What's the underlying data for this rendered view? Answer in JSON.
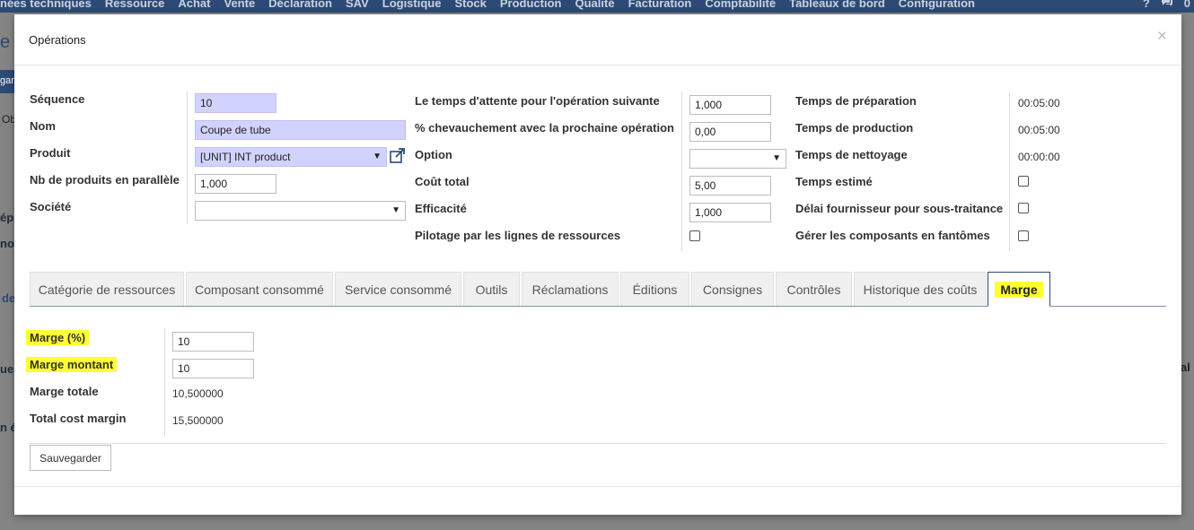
{
  "topnav": {
    "items": [
      "nées techniques",
      "Ressource",
      "Achat",
      "Vente",
      "Déclaration",
      "SAV",
      "Logistique",
      "Stock",
      "Production",
      "Qualité",
      "Facturation",
      "Comptabilité",
      "Tableaux de bord",
      "Configuration"
    ],
    "right": [
      "?",
      "0"
    ]
  },
  "background": {
    "fragments": [
      "e",
      "gar",
      "Ob",
      "ép",
      "no",
      "de",
      "ue",
      "n é"
    ],
    "right_fragments": [
      "al d"
    ]
  },
  "modal": {
    "title": "Opérations",
    "close": "×",
    "col1": {
      "sequence": {
        "label": "Séquence",
        "value": "10"
      },
      "nom": {
        "label": "Nom",
        "value": "Coupe de tube"
      },
      "produit": {
        "label": "Produit",
        "value": "[UNIT] INT product"
      },
      "nb_paralleles": {
        "label": "Nb de produits en parallèle",
        "value": "1,000"
      },
      "societe": {
        "label": "Société",
        "value": ""
      }
    },
    "col2": {
      "temps_attente": {
        "label": "Le temps d'attente pour l'opération suivante",
        "value": "1,000"
      },
      "chevauchement": {
        "label": "% chevauchement avec la prochaine opération",
        "value": "0,00"
      },
      "option": {
        "label": "Option",
        "value": ""
      },
      "cout_total": {
        "label": "Coût total",
        "value": "5,00"
      },
      "efficacite": {
        "label": "Efficacité",
        "value": "1,000"
      },
      "pilotage": {
        "label": "Pilotage par les lignes de ressources",
        "checked": false
      }
    },
    "col3": {
      "temps_preparation": {
        "label": "Temps de préparation",
        "value": "00:05:00"
      },
      "temps_production": {
        "label": "Temps de production",
        "value": "00:05:00"
      },
      "temps_nettoyage": {
        "label": "Temps de nettoyage",
        "value": "00:00:00"
      },
      "temps_estime": {
        "label": "Temps estimé",
        "checked": false
      },
      "delai_fournisseur": {
        "label": "Délai fournisseur pour sous-traitance",
        "checked": false
      },
      "gerer_composants": {
        "label": "Gérer les composants en fantômes",
        "checked": false
      }
    },
    "tabs": [
      {
        "label": "Catégorie de ressources",
        "active": false
      },
      {
        "label": "Composant consommé",
        "active": false
      },
      {
        "label": "Service consommé",
        "active": false
      },
      {
        "label": "Outils",
        "active": false
      },
      {
        "label": "Réclamations",
        "active": false
      },
      {
        "label": "Éditions",
        "active": false
      },
      {
        "label": "Consignes",
        "active": false
      },
      {
        "label": "Contrôles",
        "active": false
      },
      {
        "label": "Historique des coûts",
        "active": false
      },
      {
        "label": "Marge",
        "active": true
      }
    ],
    "marge": {
      "marge_pct": {
        "label": "Marge (%)",
        "value": "10"
      },
      "marge_montant": {
        "label": "Marge montant",
        "value": "10"
      },
      "marge_totale": {
        "label": "Marge totale",
        "value": "10,500000"
      },
      "total_cost_margin": {
        "label": "Total cost margin",
        "value": "15,500000"
      }
    },
    "save_label": "Sauvegarder",
    "highlight_color": "#ffff33",
    "required_field_color": "#d2d2ff",
    "nav_color": "#2c4a75"
  }
}
